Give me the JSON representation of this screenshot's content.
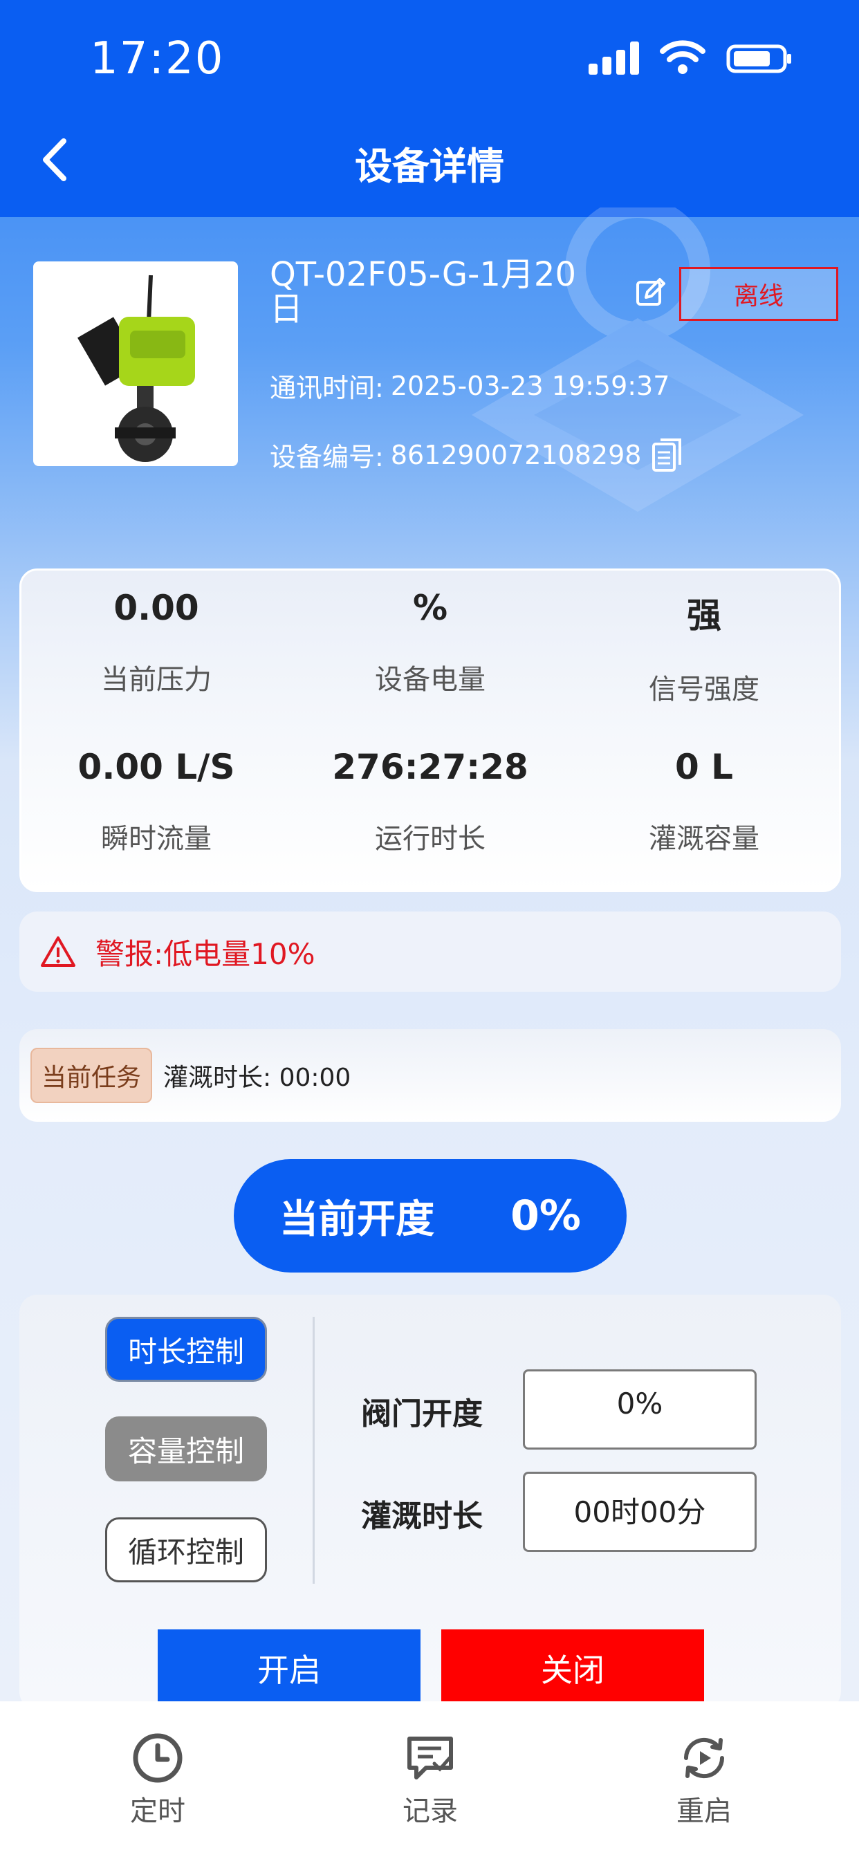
{
  "status_bar": {
    "time": "17:20"
  },
  "header": {
    "title": "设备详情"
  },
  "device": {
    "name": "QT-02F05-G-1月20日",
    "status_badge": "离线",
    "comm_time_label": "通讯时间:",
    "comm_time_value": "2025-03-23 19:59:37",
    "serial_label": "设备编号:",
    "serial_value": "861290072108298"
  },
  "stats": [
    {
      "value": "0.00",
      "label": "当前压力"
    },
    {
      "value": "%",
      "label": "设备电量"
    },
    {
      "value": "强",
      "label": "信号强度"
    },
    {
      "value": "0.00 L/S",
      "label": "瞬时流量"
    },
    {
      "value": "276:27:28",
      "label": "运行时长"
    },
    {
      "value": "0 L",
      "label": "灌溉容量"
    }
  ],
  "alert": {
    "text": "警报:低电量10%",
    "color": "#e01822"
  },
  "task": {
    "badge": "当前任务",
    "text": "灌溉时长: 00:00"
  },
  "opening": {
    "label": "当前开度",
    "value": "0%"
  },
  "control": {
    "modes": [
      "时长控制",
      "容量控制",
      "循环控制"
    ],
    "valve_label": "阀门开度",
    "valve_value": "0%",
    "duration_label": "灌溉时长",
    "duration_value": "00时00分",
    "open_button": "开启",
    "close_button": "关闭"
  },
  "tabbar": {
    "items": [
      "定时",
      "记录",
      "重启"
    ]
  },
  "colors": {
    "primary": "#0a5ef2",
    "danger": "#ff0000",
    "alert": "#e01822"
  }
}
